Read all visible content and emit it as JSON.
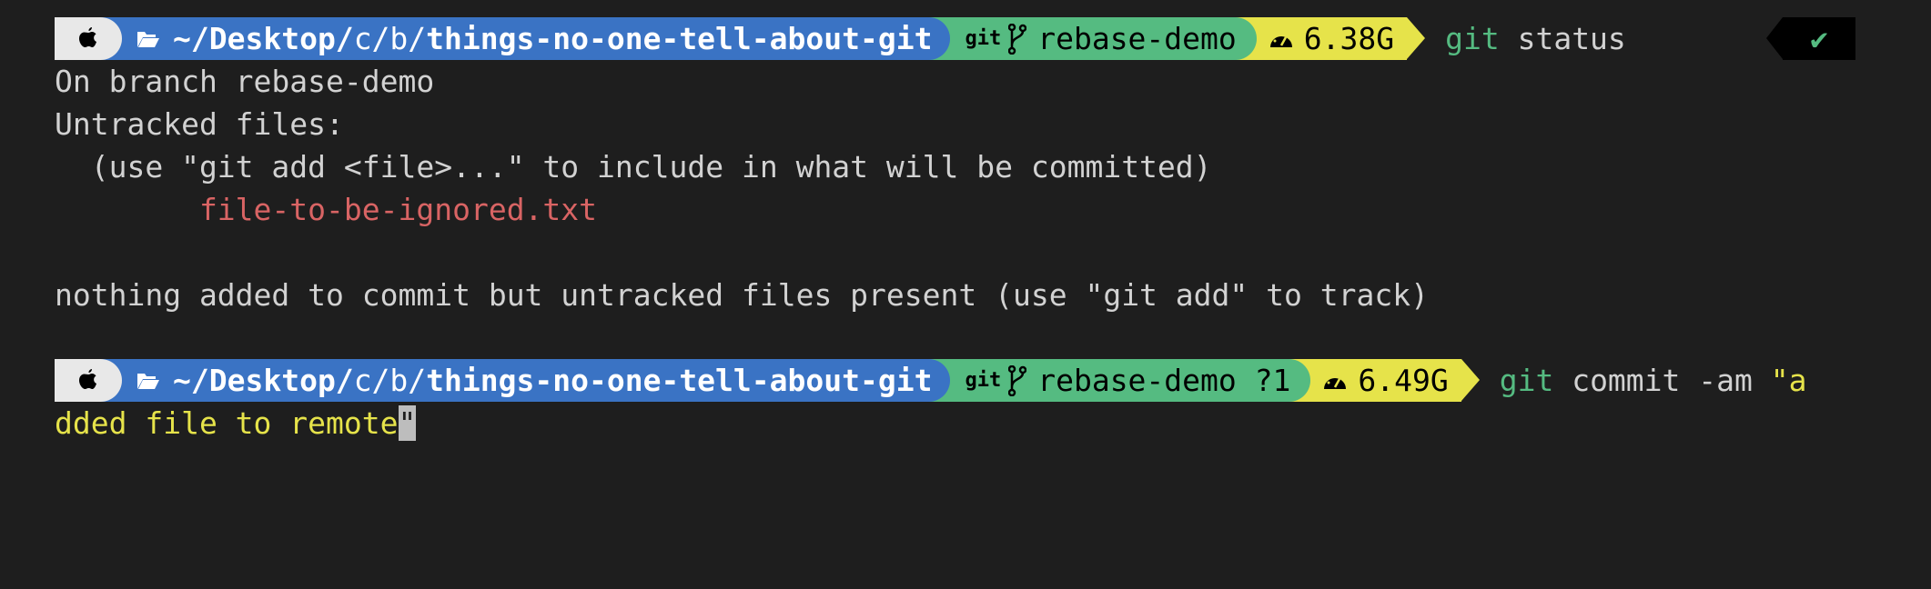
{
  "colors": {
    "background": "#1e1e1e",
    "dir_segment": "#3a73c4",
    "git_segment": "#55bb81",
    "mem_segment": "#e6e34a",
    "untracked_file": "#d96464"
  },
  "prompts": [
    {
      "icon": "apple-icon",
      "dir_prefix": "~/Desktop/",
      "dir_mid": "c/b/",
      "dir_name": "things-no-one-tell-about-git",
      "git_label": "git",
      "branch": "rebase-demo",
      "memory": "6.38G",
      "cmd_git": "git",
      "cmd_rest": " status",
      "status": "✔"
    },
    {
      "icon": "apple-icon",
      "dir_prefix": "~/Desktop/",
      "dir_mid": "c/b/",
      "dir_name": "things-no-one-tell-about-git",
      "git_label": "git",
      "branch": "rebase-demo ?1",
      "memory": "6.49G",
      "cmd_git": "git",
      "cmd_rest": " commit -am ",
      "cmd_string_start": "\"a",
      "cmd_string_cont": "dded file to remote",
      "cursor_char": "\""
    }
  ],
  "output": [
    "On branch rebase-demo",
    "Untracked files:",
    "  (use \"git add <file>...\" to include in what will be committed)",
    "        file-to-be-ignored.txt",
    "",
    "nothing added to commit but untracked files present (use \"git add\" to track)"
  ]
}
